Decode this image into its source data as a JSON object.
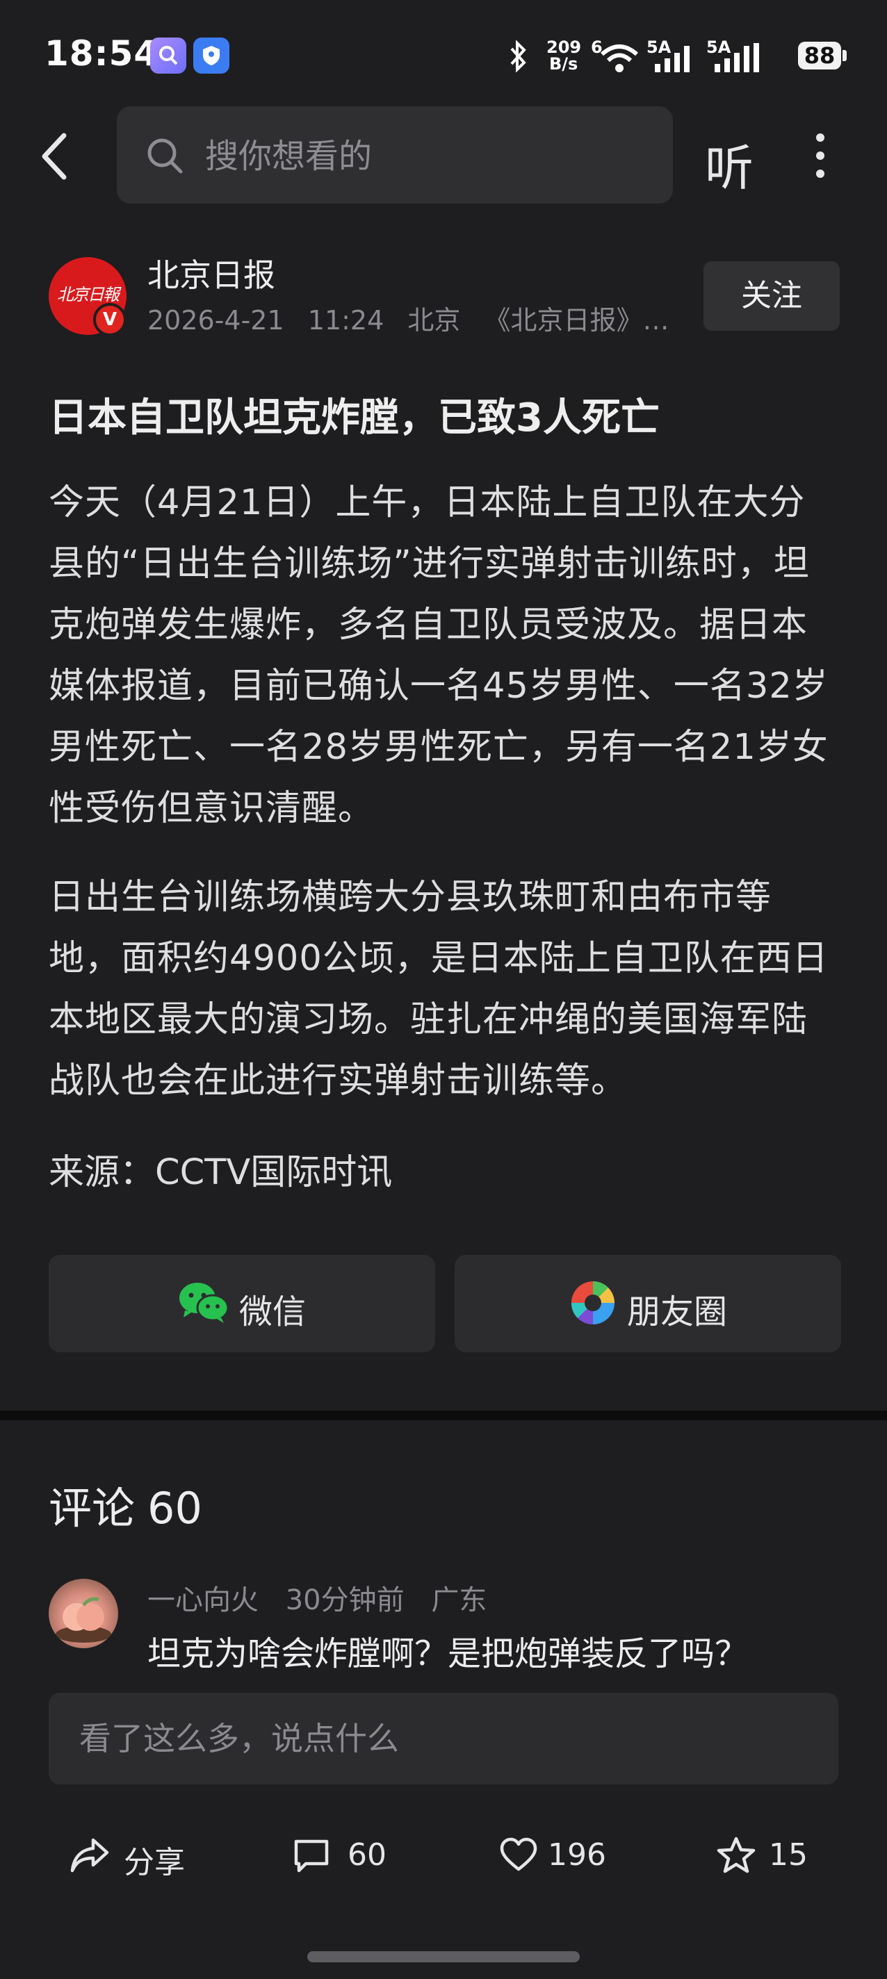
{
  "status_bar": {
    "time": "18:54",
    "net_speed_value": "209",
    "net_speed_unit": "B/s",
    "wifi_label": "6",
    "sim1_label": "5A",
    "sim2_label": "5A",
    "battery": "88"
  },
  "search": {
    "placeholder": "搜你想看的"
  },
  "header": {
    "listen_label": "听"
  },
  "author": {
    "name": "北京日报",
    "logo_text": "北京日報",
    "verified_mark": "V",
    "date": "2026-4-21",
    "time": "11:24",
    "location": "北京",
    "publication": "《北京日报》官方账号"
  },
  "follow_label": "关注",
  "article": {
    "title": "日本自卫队坦克炸膛，已致3人死亡",
    "paragraphs": [
      "今天（4月21日）上午，日本陆上自卫队在大分县的“日出生台训练场”进行实弹射击训练时，坦克炮弹发生爆炸，多名自卫队员受波及。据日本媒体报道，目前已确认一名45岁男性、一名32岁男性死亡、一名28岁男性死亡，另有一名21岁女性受伤但意识清醒。",
      "日出生台训练场横跨大分县玖珠町和由布市等地，面积约4900公顷，是日本陆上自卫队在西日本地区最大的演习场。驻扎在冲绳的美国海军陆战队也会在此进行实弹射击训练等。"
    ],
    "source": "来源：CCTV国际时讯"
  },
  "share": {
    "wechat_label": "微信",
    "moments_label": "朋友圈"
  },
  "comments": {
    "heading": "评论",
    "count": "60",
    "items": [
      {
        "user": "一心向火",
        "time": "30分钟前",
        "location": "广东",
        "text": "坦克为啥会炸膛啊？是把炮弹装反了吗？"
      }
    ],
    "input_placeholder": "看了这么多，说点什么"
  },
  "actions": {
    "share_label": "分享",
    "comment_count": "60",
    "like_count": "196",
    "fav_count": "15"
  },
  "colors": {
    "background": "#1e1e20",
    "card": "#2c2c2f",
    "brand_red": "#d91a1d",
    "wechat_green": "#27c14f"
  }
}
